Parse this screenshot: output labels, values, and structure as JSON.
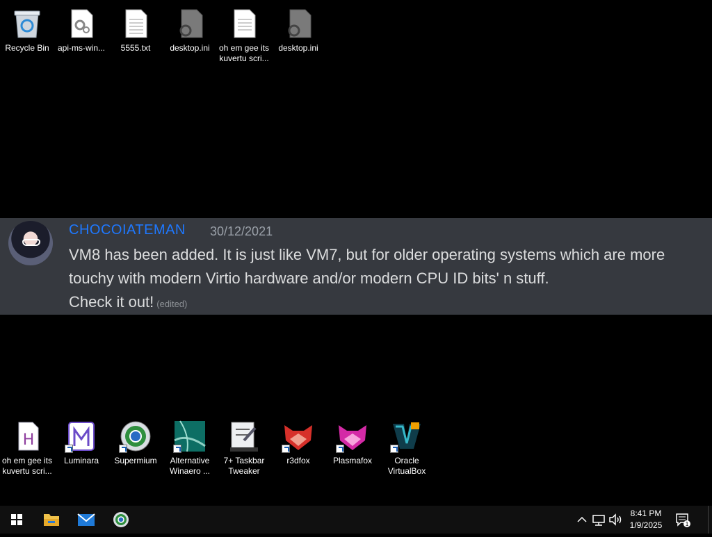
{
  "desktop": {
    "top_icons": [
      {
        "label": "Recycle Bin",
        "icon": "recycle-bin-icon"
      },
      {
        "label": "api-ms-win...",
        "icon": "system-file-icon"
      },
      {
        "label": "5555.txt",
        "icon": "text-file-icon"
      },
      {
        "label": "desktop.ini",
        "icon": "settings-file-icon"
      },
      {
        "label": "oh em gee its kuvertu scri...",
        "icon": "text-file-icon"
      },
      {
        "label": "desktop.ini",
        "icon": "settings-file-icon"
      }
    ],
    "bottom_icons": [
      {
        "label": "oh em gee its kuvertu scri...",
        "icon": "html-file-icon"
      },
      {
        "label": "Luminara",
        "icon": "luminara-icon"
      },
      {
        "label": "Supermium",
        "icon": "supermium-icon"
      },
      {
        "label": "Alternative Winaero ...",
        "icon": "winaero-icon"
      },
      {
        "label": "7+ Taskbar Tweaker",
        "icon": "taskbar-tweaker-icon"
      },
      {
        "label": "r3dfox",
        "icon": "r3dfox-icon"
      },
      {
        "label": "Plasmafox",
        "icon": "plasmafox-icon"
      },
      {
        "label": "Oracle VirtualBox",
        "icon": "virtualbox-icon"
      }
    ]
  },
  "message": {
    "username": "CHOCOIATEMAN",
    "date": "30/12/2021",
    "body": "VM8 has been added. It is just like VM7, but for older operating systems which are more touchy with modern Virtio hardware and/or modern CPU ID bits' n stuff.",
    "line3": "Check it out!",
    "edited": "(edited)",
    "colors": {
      "username": "#1e78ff",
      "background": "#36393f",
      "text": "#dcddde"
    }
  },
  "taskbar": {
    "pinned": [
      "start-icon",
      "file-explorer-icon",
      "mail-icon",
      "supermium-icon"
    ],
    "tray": [
      "chevron-up-icon",
      "network-icon",
      "volume-icon"
    ],
    "clock_time": "8:41 PM",
    "clock_date": "1/9/2025",
    "notification_count": "1"
  }
}
